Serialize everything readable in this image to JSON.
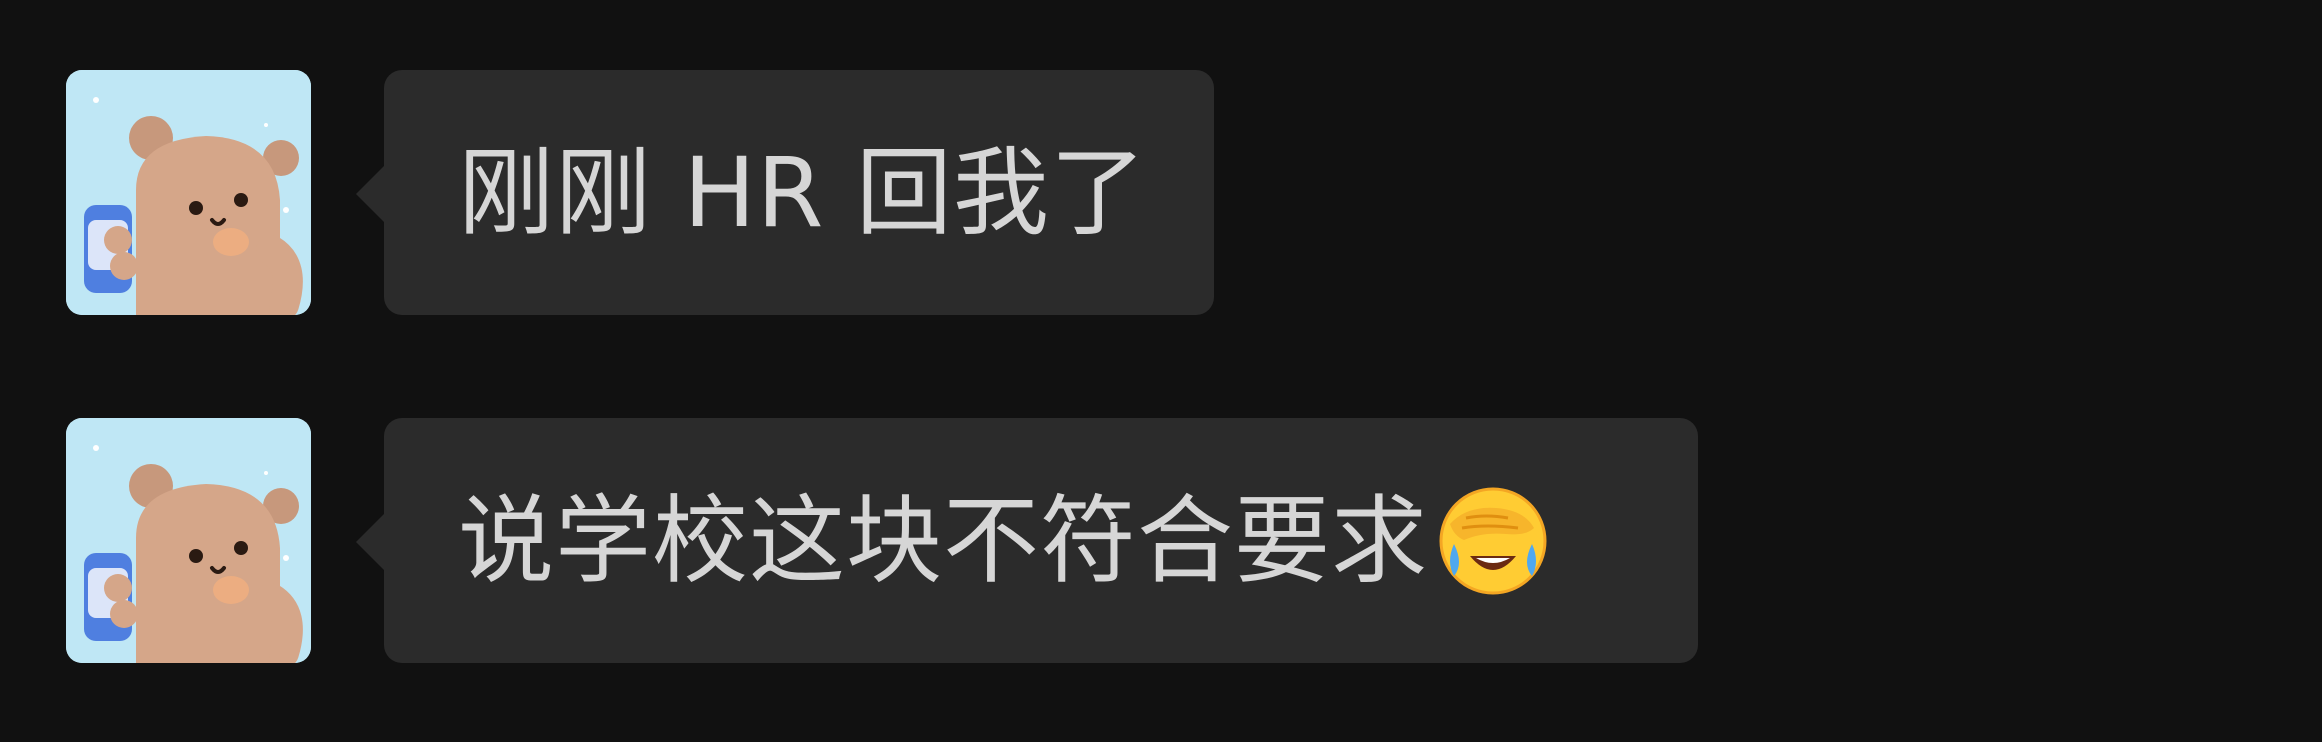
{
  "messages": [
    {
      "sender_avatar": "bear-holding-can-avatar",
      "text": "刚刚 HR 回我了",
      "emoji": null
    },
    {
      "sender_avatar": "bear-holding-can-avatar",
      "text": "说学校这块不符合要求",
      "emoji": "face-palm-crying-emoji"
    }
  ],
  "colors": {
    "background": "#111111",
    "bubble": "#2b2b2b",
    "text": "#d6d6d6",
    "avatar_background": "#bfe7f5"
  }
}
